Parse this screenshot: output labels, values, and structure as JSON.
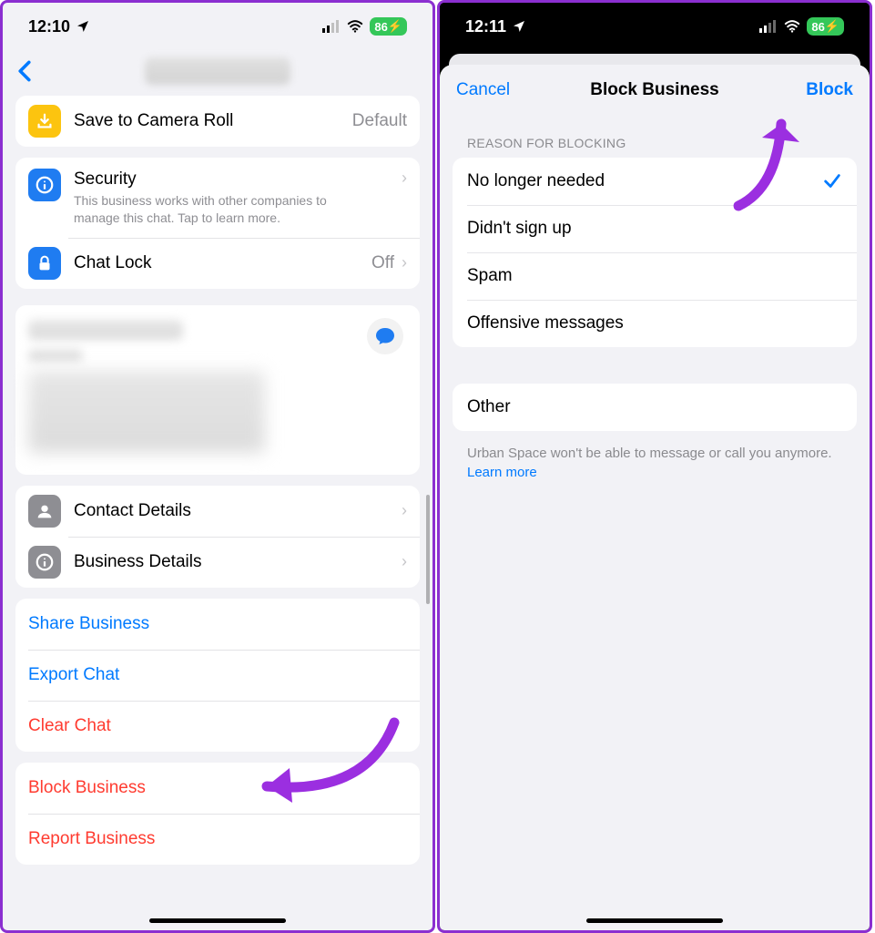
{
  "left": {
    "status": {
      "time": "12:10",
      "battery": "86"
    },
    "rows": {
      "save": {
        "label": "Save to Camera Roll",
        "value": "Default"
      },
      "security": {
        "label": "Security",
        "sub": "This business works with other companies to manage this chat. Tap to learn more."
      },
      "chatlock": {
        "label": "Chat Lock",
        "value": "Off"
      },
      "contact": {
        "label": "Contact Details"
      },
      "business": {
        "label": "Business Details"
      }
    },
    "actions": {
      "share": "Share Business",
      "export": "Export Chat",
      "clear": "Clear Chat",
      "block": "Block Business",
      "report": "Report Business"
    }
  },
  "right": {
    "status": {
      "time": "12:11",
      "battery": "86"
    },
    "nav": {
      "cancel": "Cancel",
      "title": "Block Business",
      "block": "Block"
    },
    "sectionHeader": "REASON FOR BLOCKING",
    "reasons": {
      "r1": "No longer needed",
      "r2": "Didn't sign up",
      "r3": "Spam",
      "r4": "Offensive messages",
      "other": "Other"
    },
    "footer": {
      "text": "Urban Space won't be able to message or call you anymore. ",
      "link": "Learn more"
    }
  }
}
